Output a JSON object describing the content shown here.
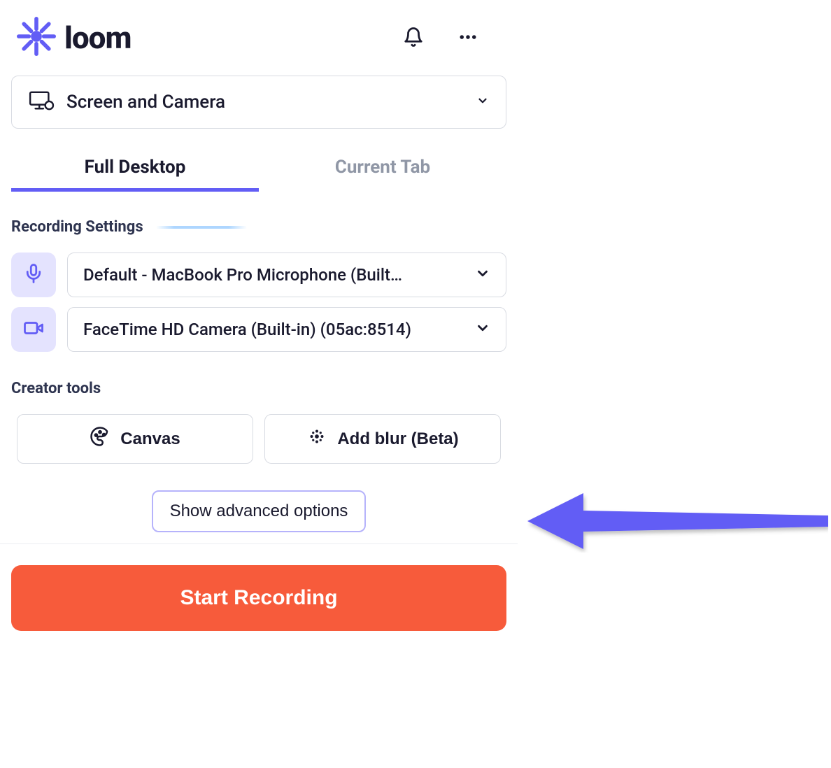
{
  "header": {
    "brand": "loom"
  },
  "mode": {
    "selected": "Screen and Camera"
  },
  "tabs": [
    {
      "label": "Full Desktop",
      "active": true
    },
    {
      "label": "Current Tab",
      "active": false
    }
  ],
  "settings": {
    "title": "Recording Settings",
    "microphone": "Default - MacBook Pro Microphone (Built…",
    "camera": "FaceTime HD Camera (Built-in) (05ac:8514)"
  },
  "creator": {
    "title": "Creator tools",
    "canvas_label": "Canvas",
    "blur_label": "Add blur (Beta)"
  },
  "advanced_label": "Show advanced options",
  "start_label": "Start Recording",
  "colors": {
    "accent": "#625df5",
    "primary_action": "#f75b3b"
  }
}
